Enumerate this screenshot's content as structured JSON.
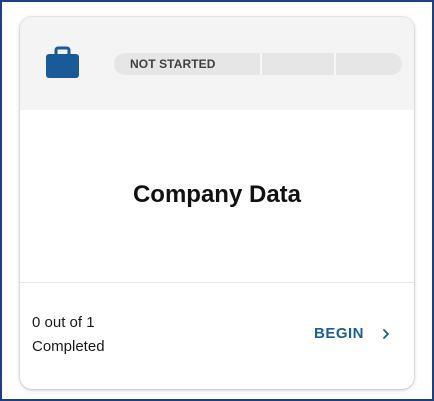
{
  "card": {
    "status_label": "NOT STARTED",
    "title": "Company Data",
    "completion_line1": "0 out of 1",
    "completion_line2": "Completed",
    "begin_label": "BEGIN"
  },
  "icons": {
    "briefcase": "briefcase-icon",
    "chevron": "chevron-right-icon"
  },
  "colors": {
    "frame_border": "#1d3f86",
    "icon": "#1a5a99",
    "action": "#1b5e9a",
    "header_bg": "#f4f4f4",
    "progress_track": "#e6e6e6"
  },
  "progress": {
    "completed": 0,
    "total": 1
  }
}
